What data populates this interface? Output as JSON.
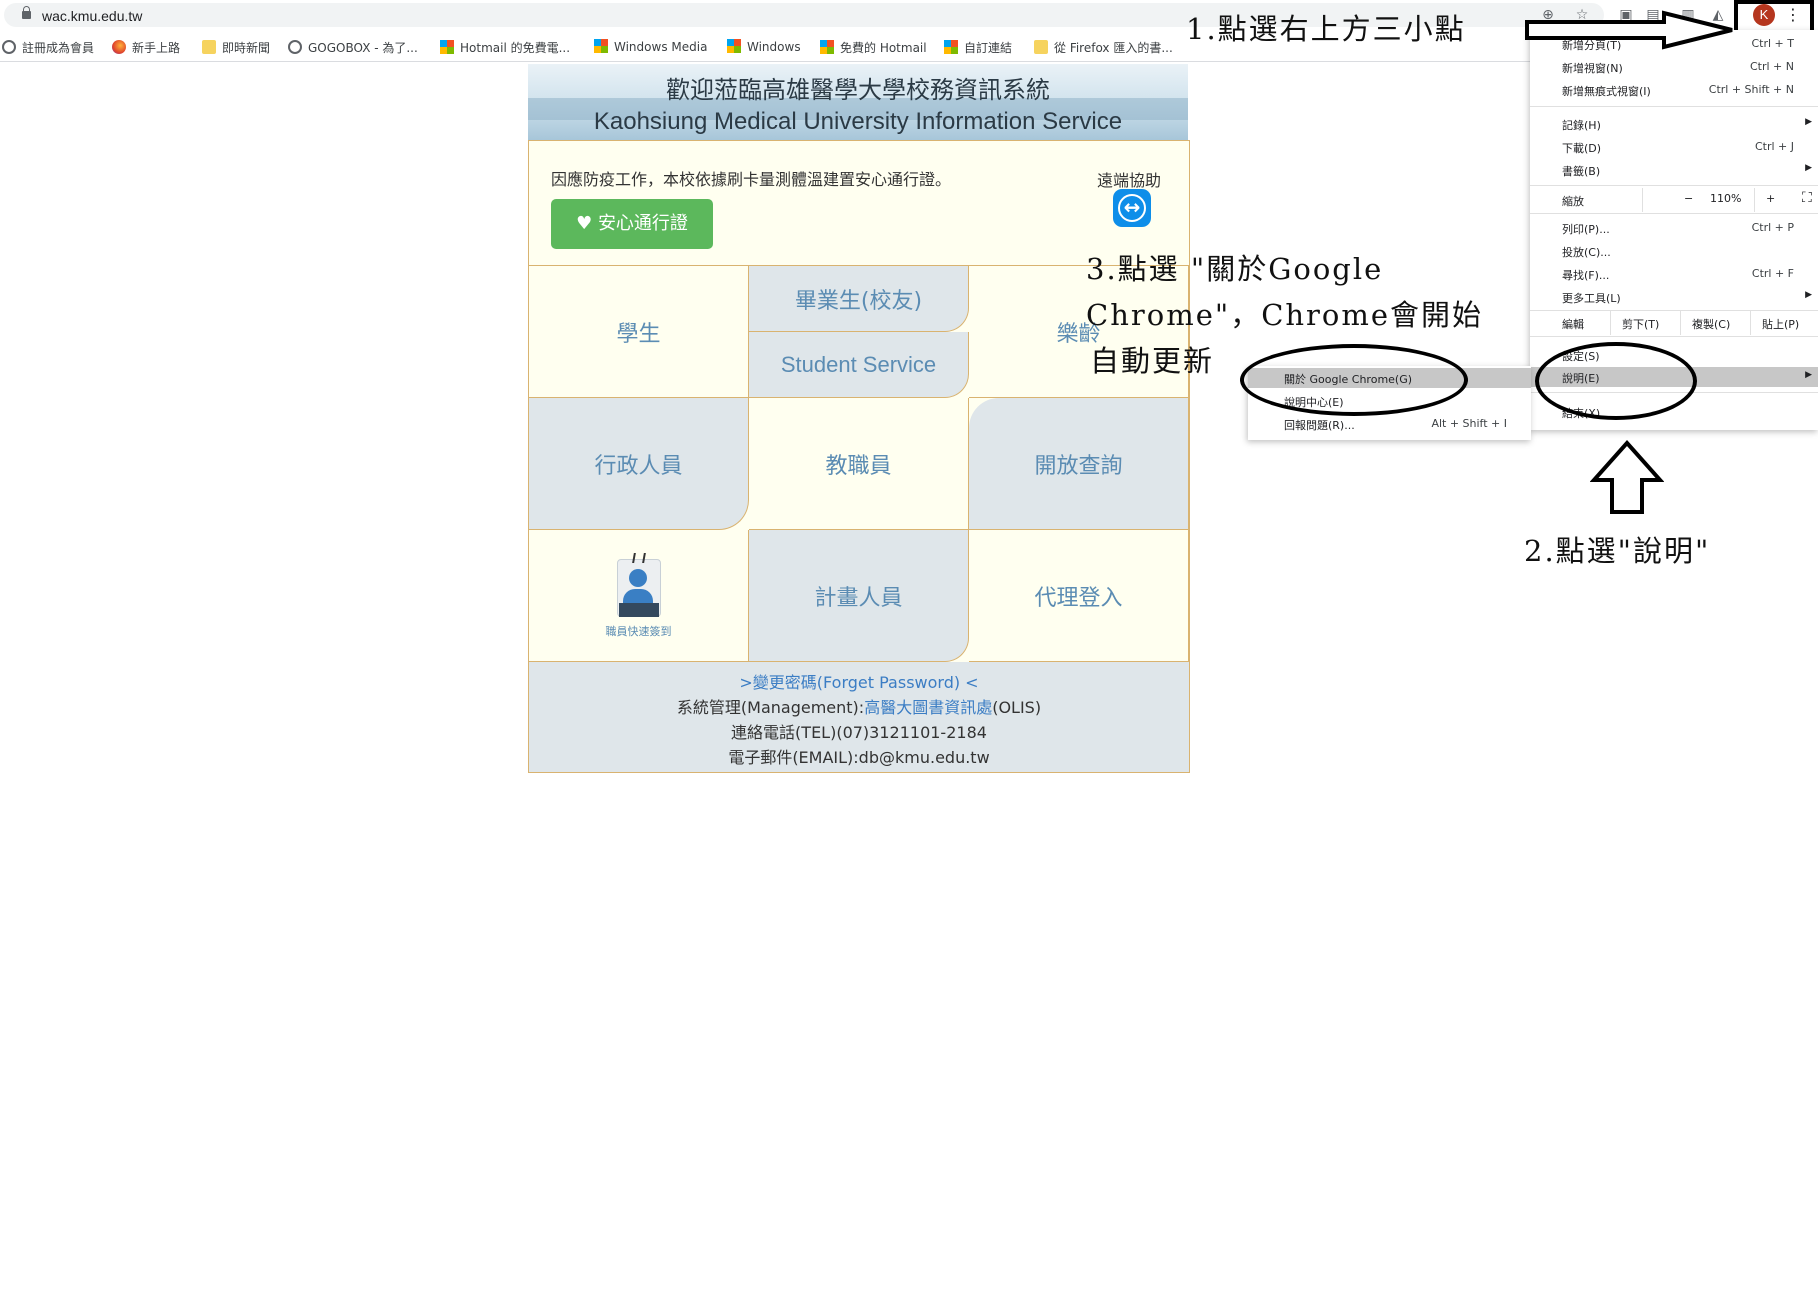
{
  "browser": {
    "url": "wac.kmu.edu.tw",
    "avatar_letter": "K",
    "bookmarks": [
      {
        "label": "註冊成為會員",
        "icon": "globe-icon"
      },
      {
        "label": "新手上路",
        "icon": "firefox-icon"
      },
      {
        "label": "即時新聞",
        "icon": "folder-icon"
      },
      {
        "label": "GOGOBOX - 為了...",
        "icon": "globe-icon"
      },
      {
        "label": "Hotmail 的免費電...",
        "icon": "microsoft-icon"
      },
      {
        "label": "Windows Media",
        "icon": "microsoft-icon"
      },
      {
        "label": "Windows",
        "icon": "microsoft-icon"
      },
      {
        "label": "免費的 Hotmail",
        "icon": "microsoft-icon"
      },
      {
        "label": "自訂連結",
        "icon": "microsoft-icon"
      },
      {
        "label": "從 Firefox 匯入的書...",
        "icon": "folder-icon"
      }
    ]
  },
  "portal": {
    "title": "歡迎蒞臨高雄醫學大學校務資訊系統",
    "subtitle": "Kaohsiung Medical University Information Service",
    "notice": "因應防疫工作，本校依據刷卡量測體溫建置安心通行證。",
    "pass_button": "安心通行證",
    "remote_assist": "遠端協助",
    "cells": {
      "student": "學生",
      "alumni": "畢業生(校友)",
      "student_service": "Student Service",
      "lohas": "樂齡",
      "admin": "行政人員",
      "staff": "教職員",
      "open_query": "開放查詢",
      "checkin": "職員快速簽到",
      "project": "計畫人員",
      "proxy": "代理登入"
    },
    "footer": {
      "password": ">變更密碼(Forget Password) <",
      "mgmt_prefix": "系統管理(Management):",
      "mgmt_link": "高醫大圖書資訊處",
      "mgmt_suffix": "(OLIS)",
      "tel": "連絡電話(TEL)(07)3121101-2184",
      "email": "電子郵件(EMAIL):db@kmu.edu.tw"
    }
  },
  "menu": {
    "new_tab": "新增分頁(T)",
    "new_tab_sc": "Ctrl + T",
    "new_window": "新增視窗(N)",
    "new_window_sc": "Ctrl + N",
    "incognito": "新增無痕式視窗(I)",
    "incognito_sc": "Ctrl + Shift + N",
    "history": "記錄(H)",
    "downloads": "下載(D)",
    "downloads_sc": "Ctrl + J",
    "bookmarks": "書籤(B)",
    "zoom": "縮放",
    "zoom_minus": "−",
    "zoom_value": "110%",
    "zoom_plus": "+",
    "print": "列印(P)...",
    "print_sc": "Ctrl + P",
    "cast": "投放(C)...",
    "find": "尋找(F)...",
    "find_sc": "Ctrl + F",
    "more_tools": "更多工具(L)",
    "edit": "編輯",
    "cut": "剪下(T)",
    "copy": "複製(C)",
    "paste": "貼上(P)",
    "settings": "設定(S)",
    "help": "說明(E)",
    "exit": "結束(X)"
  },
  "submenu": {
    "about": "關於 Google Chrome(G)",
    "help_center": "說明中心(E)",
    "report": "回報問題(R)...",
    "report_sc": "Alt + Shift + I"
  },
  "annotations": {
    "step1": "1.點選右上方三小點",
    "step2": "2.點選\"說明\"",
    "step3_line1": "3.點選 \"關於Google",
    "step3_line2": "Chrome\"，Chrome會開始",
    "step3_line3": "自動更新"
  }
}
